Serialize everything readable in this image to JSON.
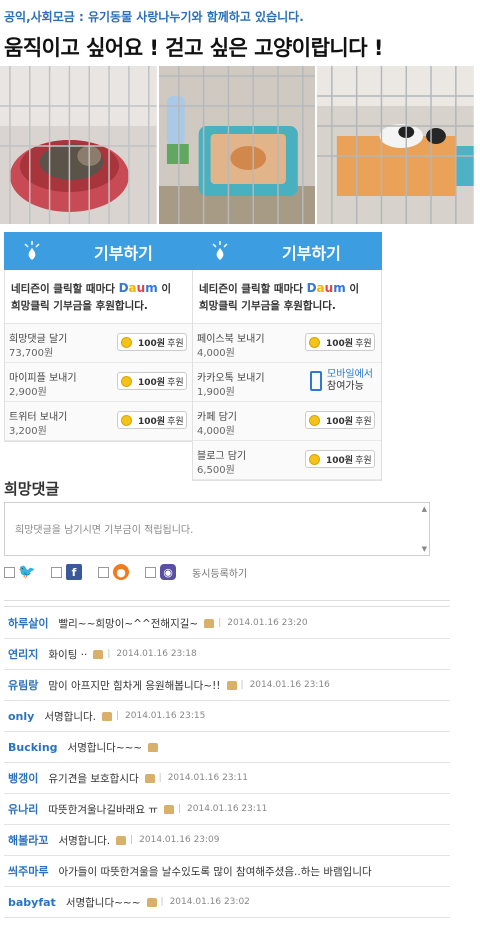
{
  "header": {
    "category": "공익,사회모금 : 유기동물 사랑나누기와 함께하고 있습니다.",
    "title": "움직이고 싶어요 ! 걷고 싶은 고양이랍니다 !"
  },
  "donate_left": {
    "button_label": "기부하기",
    "notice_line1": "네티즌이 클릭할 때마다",
    "notice_brand": "Daum",
    "notice_suffix": "이",
    "notice_line2": "희망클릭 기부금을 후원합니다.",
    "rows": [
      {
        "title": "희망댓글 달기",
        "count": "73,700원",
        "amount": "100원",
        "unit": "후원"
      },
      {
        "title": "마이피플 보내기",
        "count": "2,900원",
        "amount": "100원",
        "unit": "후원"
      },
      {
        "title": "트위터 보내기",
        "count": "3,200원",
        "amount": "100원",
        "unit": "후원"
      }
    ]
  },
  "donate_right": {
    "button_label": "기부하기",
    "notice_line1": "네티즌이 클릭할 때마다",
    "notice_brand": "Daum",
    "notice_suffix": "이",
    "notice_line2": "희망클릭 기부금을 후원합니다.",
    "rows": [
      {
        "title": "페이스북 보내기",
        "count": "4,000원",
        "amount": "100원",
        "unit": "후원"
      },
      {
        "title": "카카오톡 보내기",
        "count": "1,900원",
        "mobile_line1": "모바일에서",
        "mobile_line2": "참여가능"
      },
      {
        "title": "카페 담기",
        "count": "4,000원",
        "amount": "100원",
        "unit": "후원"
      },
      {
        "title": "블로그 담기",
        "count": "6,500원",
        "amount": "100원",
        "unit": "후원"
      }
    ]
  },
  "comments_section": {
    "title": "희망댓글",
    "placeholder": "희망댓글을 남기시면 기부금이 적립됩니다.",
    "share_label": "동시등록하기"
  },
  "comments": [
    {
      "user": "하루살이",
      "text": "빨리~~희망이~^^전해지길~",
      "time": "2014.01.16 23:20"
    },
    {
      "user": "연리지",
      "text": "화이팅 ··",
      "time": "2014.01.16 23:18"
    },
    {
      "user": "유림랑",
      "text": "맘이 아프지만 힘차게 응원해봅니다~!!",
      "time": "2014.01.16 23:16"
    },
    {
      "user": "only",
      "text": "서명합니다.",
      "time": "2014.01.16 23:15"
    },
    {
      "user": "Bucking",
      "text": "서명합니다~~~",
      "time": ""
    },
    {
      "user": "뱅갱이",
      "text": "유기견을 보호합시다",
      "time": "2014.01.16 23:11"
    },
    {
      "user": "유나리",
      "text": "따뜻한겨울나길바래요 ㅠ",
      "time": "2014.01.16 23:11"
    },
    {
      "user": "해볼라꼬",
      "text": "서명합니다.",
      "time": "2014.01.16 23:09"
    },
    {
      "user": "씌주마루",
      "text": "아가들이 따뜻한겨울을 날수있도록 많이 참여해주셨음..하는 바램입니다",
      "time": ""
    },
    {
      "user": "babyfat",
      "text": "서명합니다~~~",
      "time": "2014.01.16 23:02"
    }
  ],
  "colors": {
    "accent": "#3c9ee0",
    "link": "#2c73bf",
    "coin": "#f3c31a"
  }
}
